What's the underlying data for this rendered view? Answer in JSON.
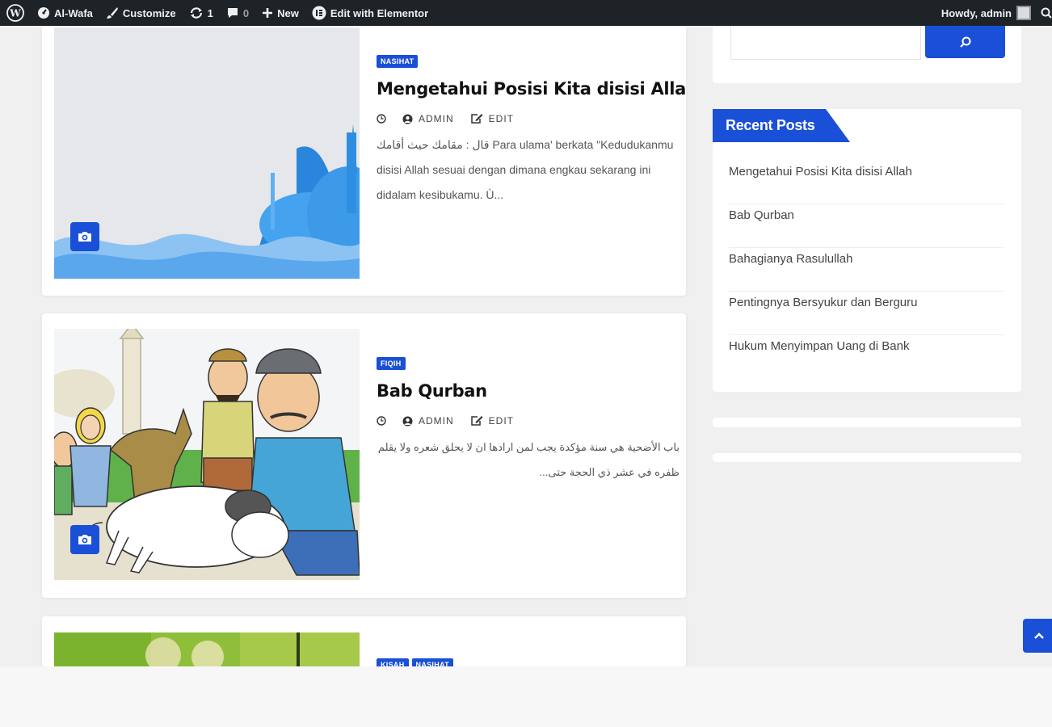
{
  "adminbar": {
    "site_name": "Al-Wafa",
    "customize": "Customize",
    "updates_count": "1",
    "comments_count": "0",
    "new_label": "New",
    "elementor_label": "Edit with Elementor",
    "howdy": "Howdy, admin"
  },
  "posts": [
    {
      "category": "NASIHAT",
      "title": "Mengetahui Posisi Kita disisi Allah",
      "author": "ADMIN",
      "edit": "EDIT",
      "excerpt": "قال : مقامك حيث أقامك Para ulama' berkata \"Kedudukanmu disisi Allah sesuai dengan dimana engkau sekarang ini didalam kesibukamu. Ù..."
    },
    {
      "category": "FIQIH",
      "title": "Bab Qurban",
      "author": "ADMIN",
      "edit": "EDIT",
      "excerpt": "باب الأضحية هي سنة مؤكدة يجب لمن ارادها ان لا يحلق شعره ولا يقلم ظفره في عشر ذي الحجة حتى..."
    },
    {
      "categories": [
        "KISAH",
        "NASIHAT"
      ]
    }
  ],
  "sidebar": {
    "recent_posts_title": "Recent Posts",
    "recent_posts": [
      "Mengetahui Posisi Kita disisi Allah",
      "Bab Qurban",
      "Bahagianya Rasulullah",
      "Pentingnya Bersyukur dan Berguru",
      "Hukum Menyimpan Uang di Bank"
    ]
  },
  "colors": {
    "accent": "#1a4fd8",
    "adminbar": "#1d2327",
    "page_bg": "#f0f0f0"
  }
}
